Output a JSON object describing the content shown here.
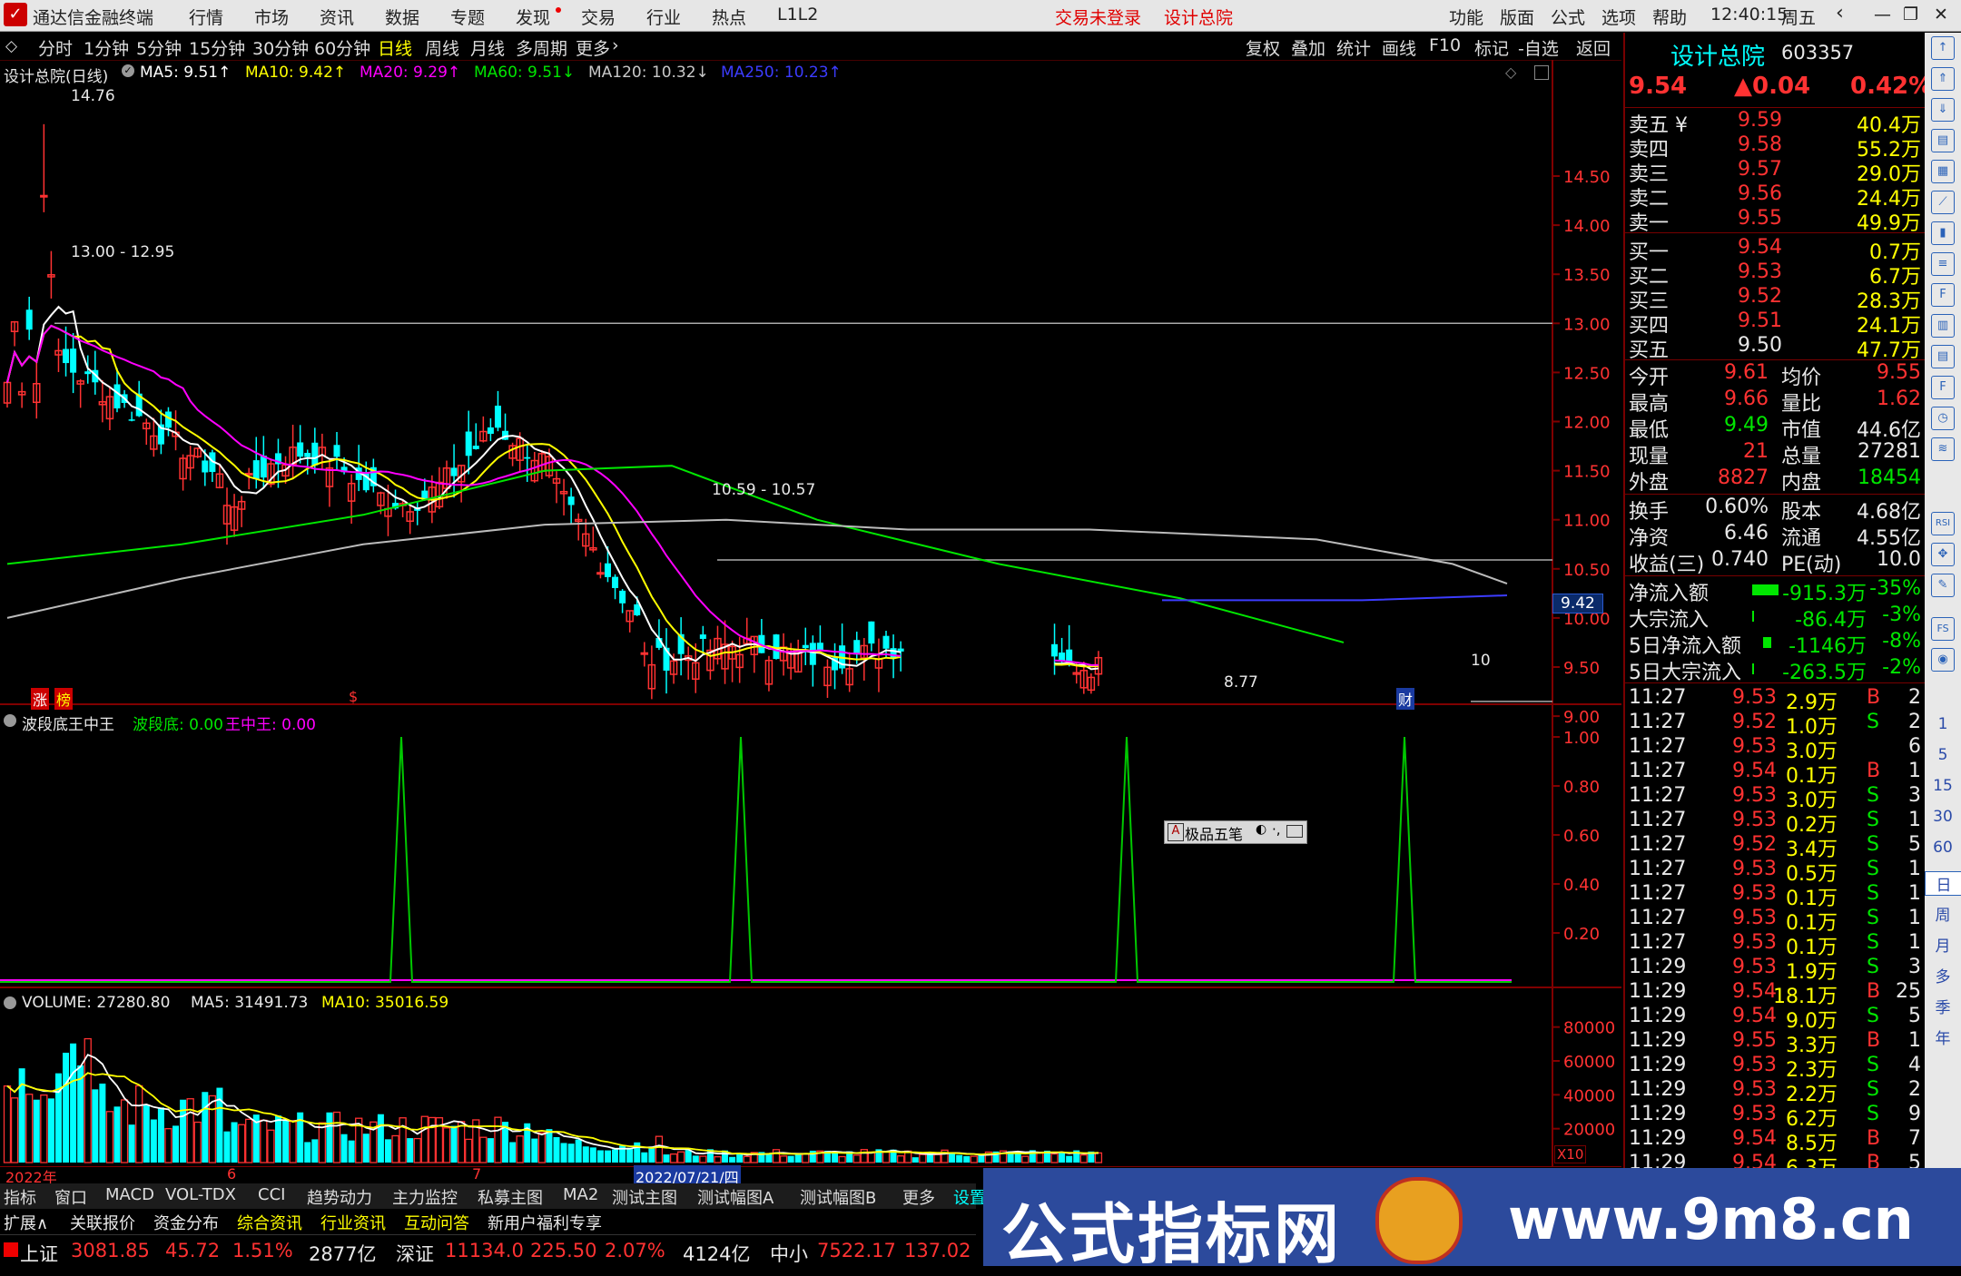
{
  "app": {
    "title": "通达信金融终端",
    "menus": [
      "行情",
      "市场",
      "资讯",
      "数据",
      "专题",
      "发现",
      "交易",
      "行业",
      "热点",
      "L1L2"
    ],
    "login_status": "交易未登录",
    "stock_name_title": "设计总院",
    "right_menus": [
      "功能",
      "版面",
      "公式",
      "选项",
      "帮助"
    ],
    "clock": "12:40:15",
    "weekday": "周五"
  },
  "periods": {
    "items": [
      "分时",
      "1分钟",
      "5分钟",
      "15分钟",
      "30分钟",
      "60分钟",
      "日线",
      "周线",
      "月线",
      "多周期",
      "更多"
    ],
    "selected": "日线"
  },
  "toolbar_right": [
    "复权",
    "叠加",
    "统计",
    "画线",
    "F10",
    "标记",
    "-自选",
    "返回"
  ],
  "main_chart": {
    "header_name": "设计总院(日线)",
    "ma": [
      {
        "label": "MA5: 9.51",
        "arrow": "↑",
        "color": "#ffffff"
      },
      {
        "label": "MA10: 9.42",
        "arrow": "↑",
        "color": "#ffff00"
      },
      {
        "label": "MA20: 9.29",
        "arrow": "↑",
        "color": "#ff00ff"
      },
      {
        "label": "MA60: 9.51",
        "arrow": "↓",
        "color": "#00e600"
      },
      {
        "label": "MA120: 10.32",
        "arrow": "↓",
        "color": "#c8c8c8"
      },
      {
        "label": "MA250: 10.23",
        "arrow": "↑",
        "color": "#3c3cff"
      }
    ],
    "price_ticks": [
      "14.50",
      "14.00",
      "13.50",
      "13.00",
      "12.50",
      "12.00",
      "11.50",
      "11.00",
      "10.50",
      "10.00",
      "9.50",
      "9.00"
    ],
    "annotations": {
      "high": "14.76",
      "range1": "13.00 - 12.95",
      "range2": "10.59 - 10.57",
      "low": "8.77",
      "last": "9.42",
      "ten": "10"
    },
    "marks": {
      "zhang": "涨",
      "bang": "榜",
      "dollar": "$",
      "cai": "财"
    }
  },
  "indicator": {
    "name": "波段底王中王",
    "line1_label": "波段底: 0.00",
    "line2_label": "王中王: 0.00",
    "ticks": [
      "1.00",
      "0.80",
      "0.60",
      "0.40",
      "0.20"
    ]
  },
  "popup": {
    "label": "极品五笔"
  },
  "volume": {
    "header": "VOLUME: 27280.80",
    "ma5": "MA5: 31491.73",
    "ma10": "MA10: 35016.59",
    "ticks": [
      "80000",
      "60000",
      "40000",
      "20000"
    ],
    "unit": "X10"
  },
  "xaxis": {
    "labels": [
      "2022年",
      "6",
      "7",
      "2022/07/21/四"
    ]
  },
  "quote": {
    "name": "设计总院",
    "code": "603357",
    "price": "9.54",
    "change": "▲0.04",
    "pct": "0.42%",
    "sells": [
      {
        "label": "卖五 ¥",
        "price": "9.59",
        "vol": "40.4万"
      },
      {
        "label": "卖四",
        "price": "9.58",
        "vol": "55.2万"
      },
      {
        "label": "卖三",
        "price": "9.57",
        "vol": "29.0万"
      },
      {
        "label": "卖二",
        "price": "9.56",
        "vol": "24.4万"
      },
      {
        "label": "卖一",
        "price": "9.55",
        "vol": "49.9万"
      }
    ],
    "buys": [
      {
        "label": "买一",
        "price": "9.54",
        "vol": "0.7万"
      },
      {
        "label": "买二",
        "price": "9.53",
        "vol": "6.7万"
      },
      {
        "label": "买三",
        "price": "9.52",
        "vol": "28.3万"
      },
      {
        "label": "买四",
        "price": "9.51",
        "vol": "24.1万"
      },
      {
        "label": "买五",
        "price": "9.50",
        "vol": "47.7万"
      }
    ],
    "stats": [
      {
        "l1": "今开",
        "v1": "9.61",
        "l2": "均价",
        "v2": "9.55",
        "c1": "red",
        "c2": "red"
      },
      {
        "l1": "最高",
        "v1": "9.66",
        "l2": "量比",
        "v2": "1.62",
        "c1": "red",
        "c2": "red"
      },
      {
        "l1": "最低",
        "v1": "9.49",
        "l2": "市值",
        "v2": "44.6亿",
        "c1": "grn",
        "c2": "wht"
      },
      {
        "l1": "现量",
        "v1": "21",
        "l2": "总量",
        "v2": "27281",
        "c1": "red",
        "c2": "wht"
      },
      {
        "l1": "外盘",
        "v1": "8827",
        "l2": "内盘",
        "v2": "18454",
        "c1": "red",
        "c2": "grn"
      }
    ],
    "stats2": [
      {
        "l1": "换手",
        "v1": "0.60%",
        "l2": "股本",
        "v2": "4.68亿"
      },
      {
        "l1": "净资",
        "v1": "6.46",
        "l2": "流通",
        "v2": "4.55亿"
      },
      {
        "l1": "收益(三)",
        "v1": "0.740",
        "l2": "PE(动)",
        "v2": "10.0"
      }
    ],
    "flows": [
      {
        "l": "净流入额",
        "v": "-915.3万",
        "p": "-35%",
        "bar": 64
      },
      {
        "l": "大宗流入",
        "v": "-86.4万",
        "p": "-3%",
        "bar": 3
      },
      {
        "l": "5日净流入额",
        "v": "-1146万",
        "p": "-8%",
        "bar": 20
      },
      {
        "l": "5日大宗流入",
        "v": "-263.5万",
        "p": "-2%",
        "bar": 4
      }
    ],
    "ticks": [
      {
        "t": "11:27",
        "p": "9.53",
        "v": "2.9万",
        "s": "B",
        "n": "2"
      },
      {
        "t": "11:27",
        "p": "9.52",
        "v": "1.0万",
        "s": "S",
        "n": "2"
      },
      {
        "t": "11:27",
        "p": "9.53",
        "v": "3.0万",
        "s": "",
        "n": "6"
      },
      {
        "t": "11:27",
        "p": "9.54",
        "v": "0.1万",
        "s": "B",
        "n": "1"
      },
      {
        "t": "11:27",
        "p": "9.53",
        "v": "3.0万",
        "s": "S",
        "n": "3"
      },
      {
        "t": "11:27",
        "p": "9.53",
        "v": "0.2万",
        "s": "S",
        "n": "1"
      },
      {
        "t": "11:27",
        "p": "9.52",
        "v": "3.4万",
        "s": "S",
        "n": "5"
      },
      {
        "t": "11:27",
        "p": "9.53",
        "v": "0.5万",
        "s": "S",
        "n": "1"
      },
      {
        "t": "11:27",
        "p": "9.53",
        "v": "0.1万",
        "s": "S",
        "n": "1"
      },
      {
        "t": "11:27",
        "p": "9.53",
        "v": "0.1万",
        "s": "S",
        "n": "1"
      },
      {
        "t": "11:27",
        "p": "9.53",
        "v": "0.1万",
        "s": "S",
        "n": "1"
      },
      {
        "t": "11:29",
        "p": "9.53",
        "v": "1.9万",
        "s": "S",
        "n": "3"
      },
      {
        "t": "11:29",
        "p": "9.54",
        "v": "18.1万",
        "s": "B",
        "n": "25"
      },
      {
        "t": "11:29",
        "p": "9.54",
        "v": "9.0万",
        "s": "S",
        "n": "5"
      },
      {
        "t": "11:29",
        "p": "9.55",
        "v": "3.3万",
        "s": "B",
        "n": "1"
      },
      {
        "t": "11:29",
        "p": "9.53",
        "v": "2.3万",
        "s": "S",
        "n": "4"
      },
      {
        "t": "11:29",
        "p": "9.53",
        "v": "2.2万",
        "s": "S",
        "n": "2"
      },
      {
        "t": "11:29",
        "p": "9.53",
        "v": "6.2万",
        "s": "S",
        "n": "9"
      },
      {
        "t": "11:29",
        "p": "9.54",
        "v": "8.5万",
        "s": "B",
        "n": "7"
      },
      {
        "t": "11:29",
        "p": "9.54",
        "v": "6.3万",
        "s": "B",
        "n": "5"
      }
    ]
  },
  "sidebar": {
    "labels": [
      "1",
      "5",
      "15",
      "30",
      "60",
      "日",
      "周",
      "月",
      "多",
      "季",
      "年"
    ]
  },
  "bottom_tabs": [
    "指标",
    "窗口",
    "MACD",
    "VOL-TDX",
    "CCI",
    "趋势动力",
    "主力监控",
    "私募主图",
    "MA2",
    "测试主图",
    "测试幅图A",
    "测试幅图B",
    "更多",
    "设置"
  ],
  "bottom_tabs2": [
    "扩展∧",
    "关联报价",
    "资金分布",
    "综合资讯",
    "行业资讯",
    "互动问答",
    "新用户福利专享"
  ],
  "status": {
    "sh_name": "上证",
    "sh_val": "3081.85",
    "sh_chg": "45.72",
    "sh_pct": "1.51%",
    "sh_amt": "2877亿",
    "sz_name": "深证",
    "sz_val": "11134.0",
    "sz_chg": "225.50",
    "sz_pct": "2.07%",
    "sz_amt": "4124亿",
    "zx_name": "中小",
    "zx_val": "7522.17",
    "zx_chg": "137.02"
  },
  "banner": {
    "text1": "公式指标网",
    "text2": "www.9m8.cn"
  },
  "chart_data": [
    {
      "type": "candlestick",
      "title": "设计总院(日线)",
      "ylim": [
        8.77,
        14.76
      ],
      "ohlc_approx": {
        "start": {
          "o": 12.3,
          "c": 12.9
        },
        "peak": 14.76,
        "mid_range": [
          10.5,
          12.2
        ],
        "late_level": 9.6,
        "last_close": 9.54,
        "low": 8.77
      },
      "horizontal_levels": [
        13.0,
        10.59
      ]
    },
    {
      "type": "line",
      "title": "波段底王中王",
      "series": [
        {
          "name": "波段底",
          "spikes_at_fraction": [
            0.26,
            0.48,
            0.73,
            0.91
          ],
          "peak": 1.0
        }
      ],
      "ylim": [
        0,
        1.0
      ]
    },
    {
      "type": "bar",
      "title": "VOLUME",
      "ylim": [
        0,
        90000
      ],
      "values_approx": [
        45000,
        70000,
        82000,
        60000,
        55000,
        40000,
        30000,
        25000,
        20000,
        15000,
        10000,
        6000,
        4000
      ]
    }
  ]
}
